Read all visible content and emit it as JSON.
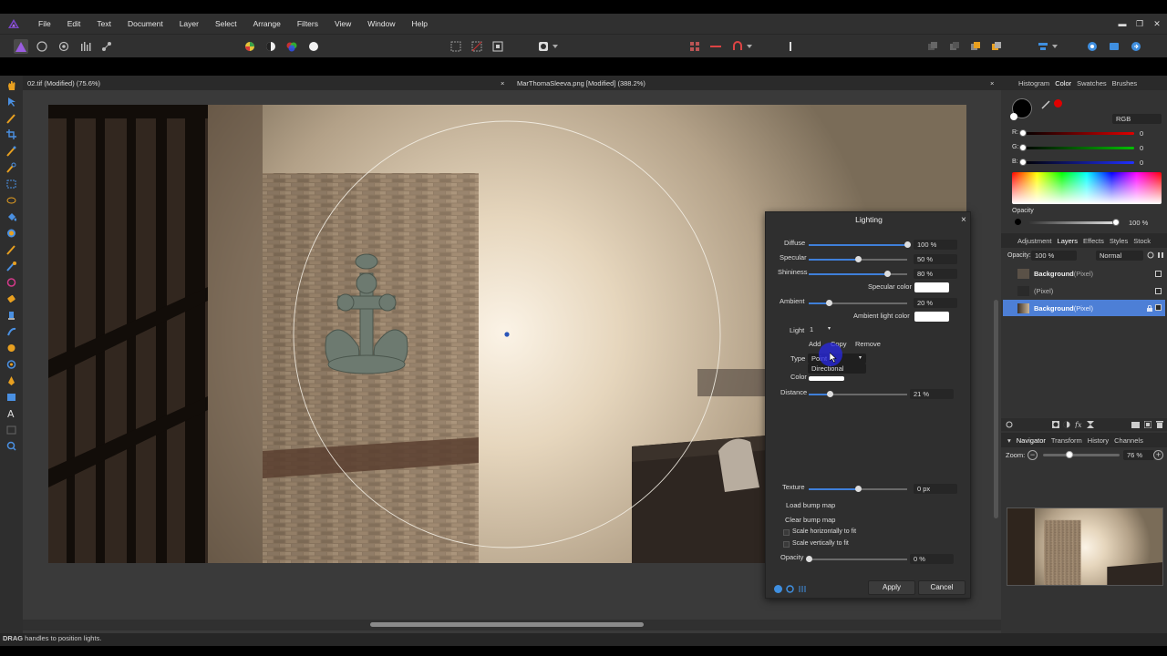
{
  "menu": {
    "items": [
      "File",
      "Edit",
      "Text",
      "Document",
      "Layer",
      "Select",
      "Arrange",
      "Filters",
      "View",
      "Window",
      "Help"
    ]
  },
  "window_controls": {
    "minimize": "▬",
    "restore": "❐",
    "close": "✕"
  },
  "tabs": [
    {
      "label": "02.tif (Modified) (75.6%)",
      "close": "×"
    },
    {
      "label": "MarThomaSleeva.png [Modified] (388.2%)",
      "close": "×"
    }
  ],
  "status": {
    "bold": "DRAG",
    "text": " handles to position lights."
  },
  "lighting": {
    "title": "Lighting",
    "close": "×",
    "diffuse": {
      "label": "Diffuse",
      "value": "100 %",
      "level": 1.0
    },
    "specular": {
      "label": "Specular",
      "value": "50 %",
      "level": 0.5
    },
    "shininess": {
      "label": "Shininess",
      "value": "80 %",
      "level": 0.8
    },
    "specular_color_label": "Specular color",
    "ambient": {
      "label": "Ambient",
      "value": "20 %",
      "level": 0.2
    },
    "ambient_color_label": "Ambient light color",
    "light_label": "Light",
    "light_value": "1",
    "add": "Add",
    "copy": "Copy",
    "remove": "Remove",
    "type_label": "Type",
    "type_value": "Point",
    "type_option_directional": "Directional",
    "color_label": "Color",
    "distance": {
      "label": "Distance",
      "value": "21 %",
      "level": 0.21
    },
    "texture": {
      "label": "Texture",
      "value": "0 px",
      "level": 0.5
    },
    "load_bump": "Load bump map",
    "clear_bump": "Clear bump map",
    "scale_h": "Scale horizontally to fit",
    "scale_v": "Scale vertically to fit",
    "opacity": {
      "label": "Opacity",
      "value": "0 %",
      "level": 0.0
    },
    "apply": "Apply",
    "cancel": "Cancel"
  },
  "color_panel": {
    "tabs": [
      "Histogram",
      "Color",
      "Swatches",
      "Brushes"
    ],
    "active_tab": "Color",
    "model": "RGB",
    "r_label": "R:",
    "r_value": "0",
    "g_label": "G:",
    "g_value": "0",
    "b_label": "B:",
    "b_value": "0",
    "opacity_label": "Opacity",
    "opacity_value": "100 %"
  },
  "layers_panel": {
    "tabs": [
      "Adjustment",
      "Layers",
      "Effects",
      "Styles",
      "Stock"
    ],
    "active_tab": "Layers",
    "opacity_label": "Opacity:",
    "opacity_value": "100 %",
    "blend_mode": "Normal",
    "layers": [
      {
        "name": "Background",
        "type": " (Pixel)"
      },
      {
        "name": "",
        "type": "(Pixel)"
      },
      {
        "name": "Background",
        "type": " (Pixel)"
      }
    ]
  },
  "navigator_panel": {
    "tabs": [
      "Navigator",
      "Transform",
      "History",
      "Channels"
    ],
    "active_tab": "Navigator",
    "zoom_label": "Zoom:",
    "zoom_value": "76 %"
  },
  "colors": {
    "accent": "#3f7fd9",
    "selected_layer": "#4d7fd6",
    "red": "#e00000",
    "green": "#00c000",
    "blue": "#2030ff"
  }
}
